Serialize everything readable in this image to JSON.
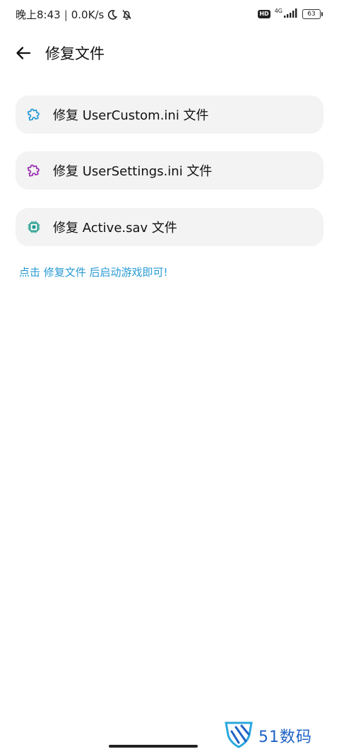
{
  "status_bar": {
    "time": "晚上8:43",
    "separator": "|",
    "net_speed": "0.0K/s",
    "hd_badge": "HD",
    "network_type": "4G",
    "battery_level": "63"
  },
  "header": {
    "title": "修复文件"
  },
  "actions": [
    {
      "label": "修复 UserCustom.ini 文件",
      "icon": "puzzle-icon",
      "color": "#2a9bd6"
    },
    {
      "label": "修复 UserSettings.ini 文件",
      "icon": "puzzle-icon",
      "color": "#9c2fb0"
    },
    {
      "label": "修复 Active.sav 文件",
      "icon": "chip-icon",
      "color": "#17998b"
    }
  ],
  "hint": "点击 修复文件 后启动游戏即可!",
  "watermark": {
    "text": "51数码"
  },
  "colors": {
    "accent_blue": "#2a9bd6",
    "accent_purple": "#9c2fb0",
    "accent_teal": "#17998b",
    "card_bg": "#f3f3f3"
  }
}
